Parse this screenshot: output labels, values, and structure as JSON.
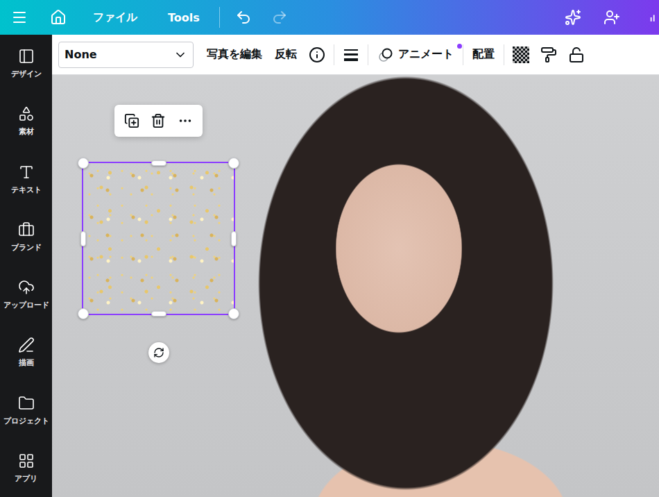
{
  "topbar": {
    "menus": [
      "ファイル",
      "Tools"
    ],
    "undo_disabled": false,
    "redo_disabled": true
  },
  "sidebar": {
    "items": [
      {
        "label": "デザイン",
        "selected": false
      },
      {
        "label": "素材",
        "selected": false
      },
      {
        "label": "テキスト",
        "selected": false
      },
      {
        "label": "ブランド",
        "selected": false
      },
      {
        "label": "アップロード",
        "selected": false
      },
      {
        "label": "描画",
        "selected": false
      },
      {
        "label": "プロジェクト",
        "selected": false
      },
      {
        "label": "アプリ",
        "selected": false
      }
    ]
  },
  "toolbar": {
    "dropdown": {
      "value": "None"
    },
    "buttons": [
      {
        "label": "写真を編集"
      },
      {
        "label": "反転"
      }
    ],
    "animate": {
      "label": "アニメート",
      "badge": true
    },
    "arrange": {
      "label": "配置"
    }
  },
  "canvas": {
    "selection": {
      "selected": true
    }
  }
}
